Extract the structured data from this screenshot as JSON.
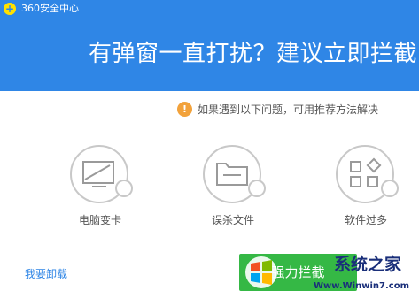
{
  "app": {
    "title": "360安全中心"
  },
  "header": {
    "headline": "有弹窗一直打扰？建议立即拦截"
  },
  "info": {
    "text": "如果遇到以下问题，可用推荐方法解决",
    "icon": "!"
  },
  "features": [
    {
      "icon": "screen-icon",
      "label": "电脑变卡"
    },
    {
      "icon": "folder-icon",
      "label": "误杀文件"
    },
    {
      "icon": "apps-icon",
      "label": "软件过多"
    }
  ],
  "footer": {
    "uninstall_label": "我要卸载",
    "block_button_label": "强力拦截"
  },
  "watermark": {
    "text": "系统之家",
    "url": "Www.Winwin7.com"
  },
  "colors": {
    "accent": "#2f86e6",
    "button": "#35b845",
    "info": "#f2a23b"
  }
}
